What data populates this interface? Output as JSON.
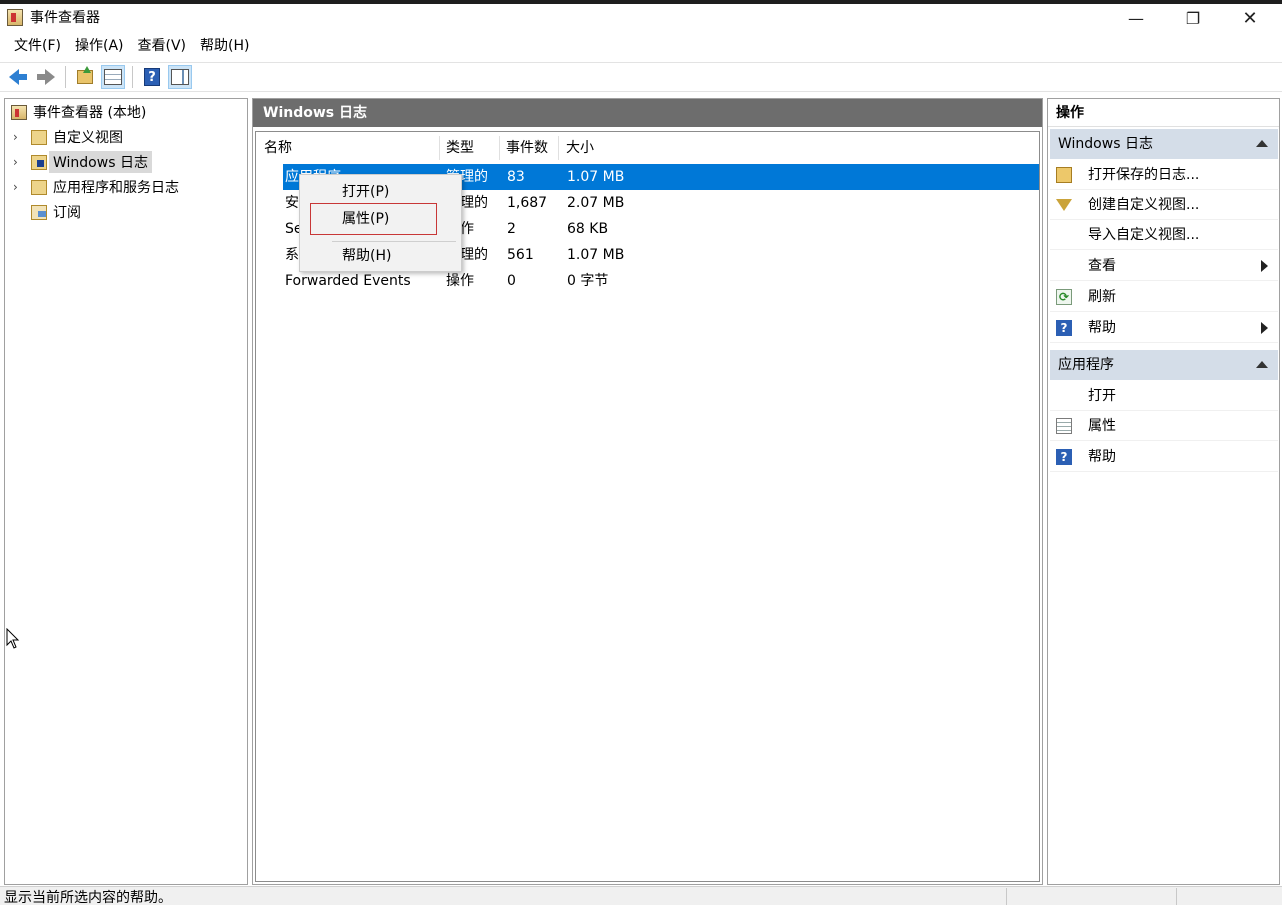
{
  "window": {
    "title": "事件查看器",
    "min_glyph": "—",
    "max_glyph": "❐",
    "close_glyph": "✕"
  },
  "menu": [
    "文件(F)",
    "操作(A)",
    "查看(V)",
    "帮助(H)"
  ],
  "toolbar": {
    "items": [
      "back-icon",
      "forward-icon",
      "folder-up-icon",
      "show-hide-tree-icon",
      "help-icon",
      "action-pane-icon"
    ],
    "help_glyph": "?"
  },
  "tree": {
    "root": "事件查看器 (本地)",
    "items": [
      {
        "label": "自定义视图",
        "icon": "custom-views-folder-icon",
        "expandable": true
      },
      {
        "label": "Windows 日志",
        "icon": "windows-logs-folder-icon",
        "expandable": true,
        "selected": true
      },
      {
        "label": "应用程序和服务日志",
        "icon": "app-services-folder-icon",
        "expandable": true
      },
      {
        "label": "订阅",
        "icon": "subscriptions-icon",
        "expandable": false
      }
    ],
    "chevron": "›"
  },
  "center": {
    "header": "Windows 日志",
    "columns": [
      "名称",
      "类型",
      "事件数",
      "大小"
    ],
    "rows": [
      {
        "name": "应用程序",
        "type": "管理的",
        "count": "83",
        "size": "1.07 MB",
        "selected": true
      },
      {
        "name": "安",
        "type": "管理的",
        "count": "1,687",
        "size": "2.07 MB"
      },
      {
        "name": "Se",
        "type": "操作",
        "count": "2",
        "size": "68 KB"
      },
      {
        "name": "系",
        "type": "管理的",
        "count": "561",
        "size": "1.07 MB"
      },
      {
        "name": "Forwarded Events",
        "type": "操作",
        "count": "0",
        "size": "0 字节"
      }
    ]
  },
  "context_menu": {
    "items": [
      "打开(P)",
      "属性(P)",
      "帮助(H)"
    ],
    "highlighted": "属性(P)"
  },
  "actions": {
    "title": "操作",
    "sections": [
      {
        "title": "Windows 日志",
        "items": [
          {
            "label": "打开保存的日志...",
            "icon": "open-log-folder-icon"
          },
          {
            "label": "创建自定义视图...",
            "icon": "filter-icon"
          },
          {
            "label": "导入自定义视图...",
            "icon": ""
          },
          {
            "label": "查看",
            "icon": "",
            "submenu": true
          },
          {
            "label": "刷新",
            "icon": "refresh-icon"
          },
          {
            "label": "帮助",
            "icon": "help-icon",
            "submenu": true
          }
        ]
      },
      {
        "title": "应用程序",
        "items": [
          {
            "label": "打开",
            "icon": ""
          },
          {
            "label": "属性",
            "icon": "properties-icon"
          },
          {
            "label": "帮助",
            "icon": "help-icon"
          }
        ]
      }
    ],
    "help_glyph": "?",
    "refresh_glyph": "⟳"
  },
  "status": {
    "text": "显示当前所选内容的帮助。"
  }
}
